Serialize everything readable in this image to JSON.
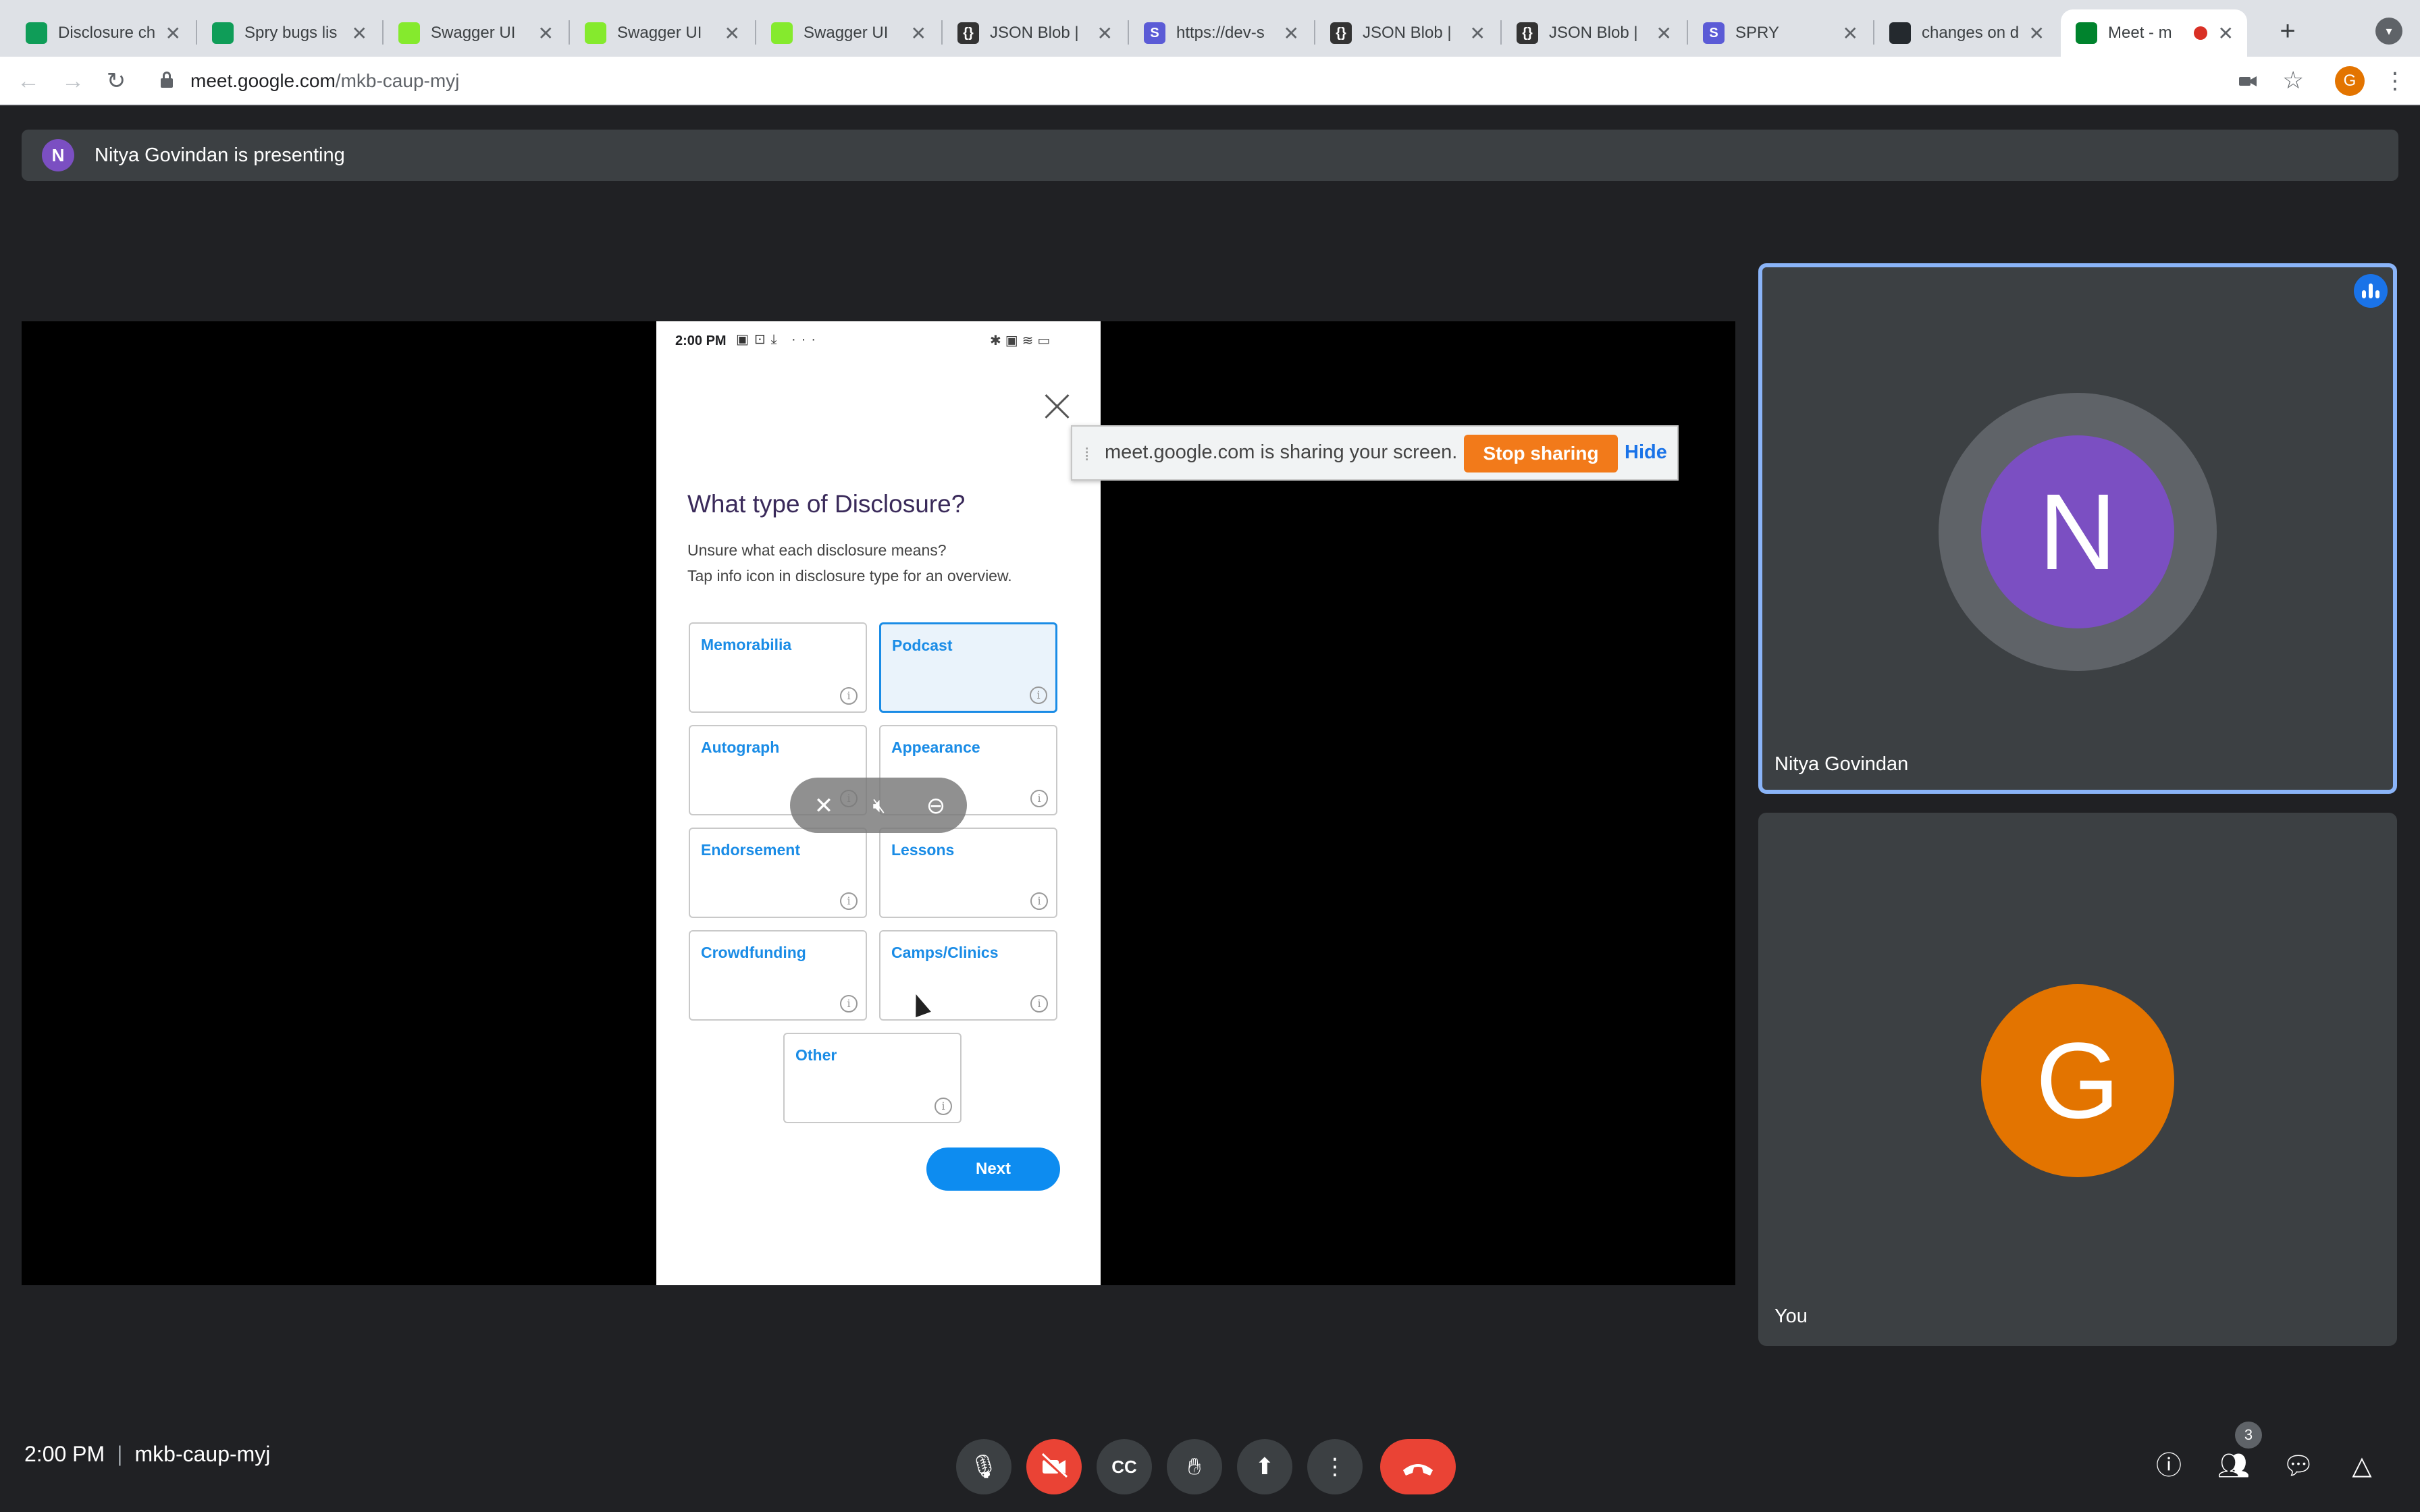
{
  "browser": {
    "tabs": [
      {
        "title": "Disclosure ch",
        "favicon": "sheets-icon",
        "color": "#0f9d58",
        "glyph": ""
      },
      {
        "title": "Spry bugs lis",
        "favicon": "sheets-icon",
        "color": "#0f9d58",
        "glyph": ""
      },
      {
        "title": "Swagger UI",
        "favicon": "swagger-icon",
        "color": "#85ea2d",
        "glyph": ""
      },
      {
        "title": "Swagger UI",
        "favicon": "swagger-icon",
        "color": "#85ea2d",
        "glyph": ""
      },
      {
        "title": "Swagger UI",
        "favicon": "swagger-icon",
        "color": "#85ea2d",
        "glyph": ""
      },
      {
        "title": "JSON Blob |",
        "favicon": "json-blob-icon",
        "color": "#333333",
        "glyph": "{}"
      },
      {
        "title": "https://dev-s",
        "favicon": "spry-icon",
        "color": "#5b5bd6",
        "glyph": "S"
      },
      {
        "title": "JSON Blob |",
        "favicon": "json-blob-icon",
        "color": "#333333",
        "glyph": "{}"
      },
      {
        "title": "JSON Blob |",
        "favicon": "json-blob-icon",
        "color": "#333333",
        "glyph": "{}"
      },
      {
        "title": "SPRY",
        "favicon": "spry-icon",
        "color": "#5b5bd6",
        "glyph": "S"
      },
      {
        "title": "changes on d",
        "favicon": "github-icon",
        "color": "#24292e",
        "glyph": ""
      },
      {
        "title": "Meet - m",
        "favicon": "meet-icon",
        "color": "#00832d",
        "glyph": "",
        "active": true
      }
    ],
    "url_host": "meet.google.com",
    "url_path": "/mkb-caup-myj",
    "profile_initial": "G",
    "new_tab_glyph": "+"
  },
  "banner": {
    "avatar_initial": "N",
    "text": "Nitya Govindan is presenting"
  },
  "shared_screen": {
    "status_time": "2:00 PM",
    "title": "What type of Disclosure?",
    "subtitle_line1": "Unsure what each disclosure means?",
    "subtitle_line2": "Tap info icon in disclosure type for an overview.",
    "options": [
      {
        "label": "Memorabilia",
        "selected": false
      },
      {
        "label": "Podcast",
        "selected": true
      },
      {
        "label": "Autograph",
        "selected": false
      },
      {
        "label": "Appearance",
        "selected": false
      },
      {
        "label": "Endorsement",
        "selected": false
      },
      {
        "label": "Lessons",
        "selected": false
      },
      {
        "label": "Crowdfunding",
        "selected": false
      },
      {
        "label": "Camps/Clinics",
        "selected": false
      },
      {
        "label": "Other",
        "selected": false
      }
    ],
    "next_label": "Next",
    "accent_color": "#1a8ce6"
  },
  "share_bar": {
    "text": "meet.google.com is sharing your screen.",
    "stop_label": "Stop sharing",
    "hide_label": "Hide",
    "stop_color": "#f27a1a"
  },
  "participants": [
    {
      "name": "Nitya Govindan",
      "initial": "N",
      "color": "#7b4fc2",
      "speaking": true
    },
    {
      "name": "You",
      "initial": "G",
      "color": "#e37400",
      "speaking": false
    }
  ],
  "bottom_bar": {
    "time": "2:00 PM",
    "meeting_code": "mkb-caup-myj",
    "people_count": "3"
  }
}
